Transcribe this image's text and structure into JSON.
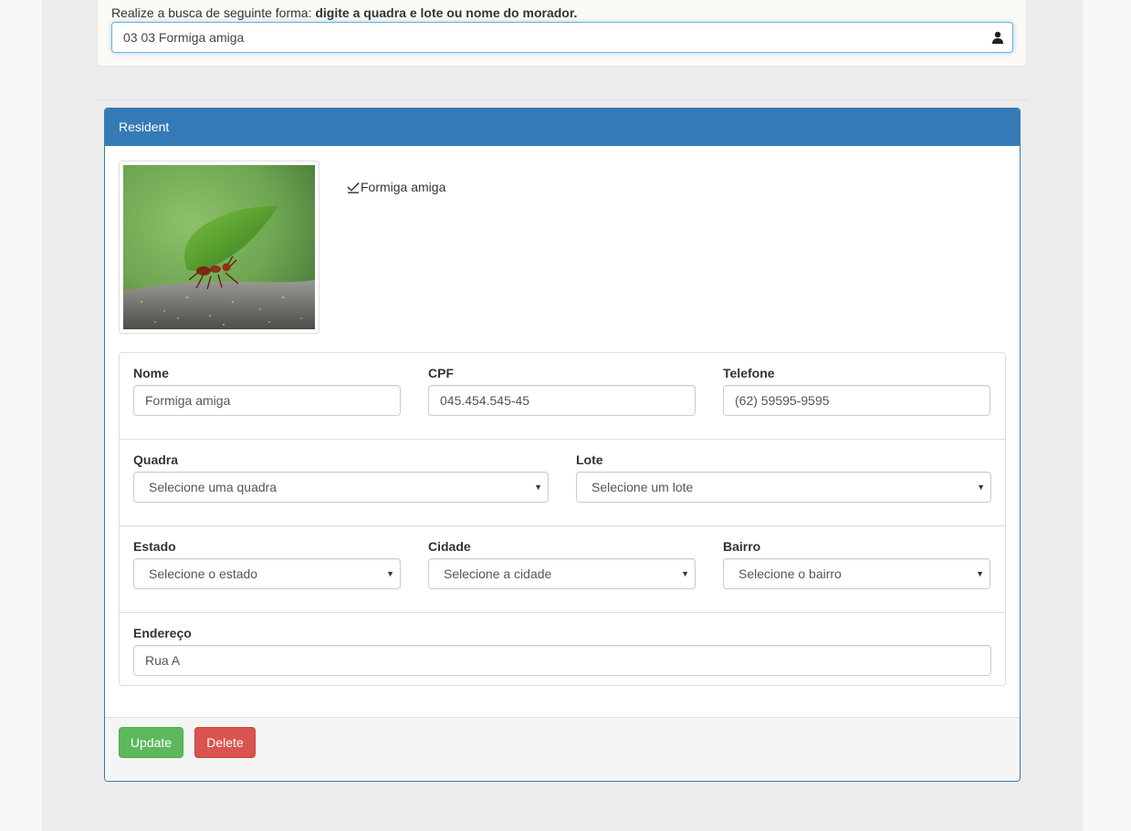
{
  "search": {
    "hint_prefix": "Realize a busca de seguinte forma:",
    "hint_bold": "digite a quadra e lote ou nome do morador.",
    "value": "03 03 Formiga amiga",
    "icon": "user-icon"
  },
  "panel": {
    "title": "Resident",
    "resident_name": "Formiga amiga",
    "name_icon": "check-icon",
    "photo_alt": "Leaf-cutter ant carrying a leaf"
  },
  "form": {
    "nome": {
      "label": "Nome",
      "value": "Formiga amiga"
    },
    "cpf": {
      "label": "CPF",
      "value": "045.454.545-45"
    },
    "telefone": {
      "label": "Telefone",
      "value": "(62) 59595-9595"
    },
    "quadra": {
      "label": "Quadra",
      "selected": "Selecione uma quadra"
    },
    "lote": {
      "label": "Lote",
      "selected": "Selecione um lote"
    },
    "estado": {
      "label": "Estado",
      "selected": "Selecione o estado"
    },
    "cidade": {
      "label": "Cidade",
      "selected": "Selecione a cidade"
    },
    "bairro": {
      "label": "Bairro",
      "selected": "Selecione o bairro"
    },
    "endereco": {
      "label": "Endereço",
      "value": "Rua A"
    }
  },
  "footer": {
    "update_label": "Update",
    "delete_label": "Delete"
  },
  "colors": {
    "primary": "#337ab7",
    "success": "#5cb85c",
    "danger": "#d9534f"
  }
}
